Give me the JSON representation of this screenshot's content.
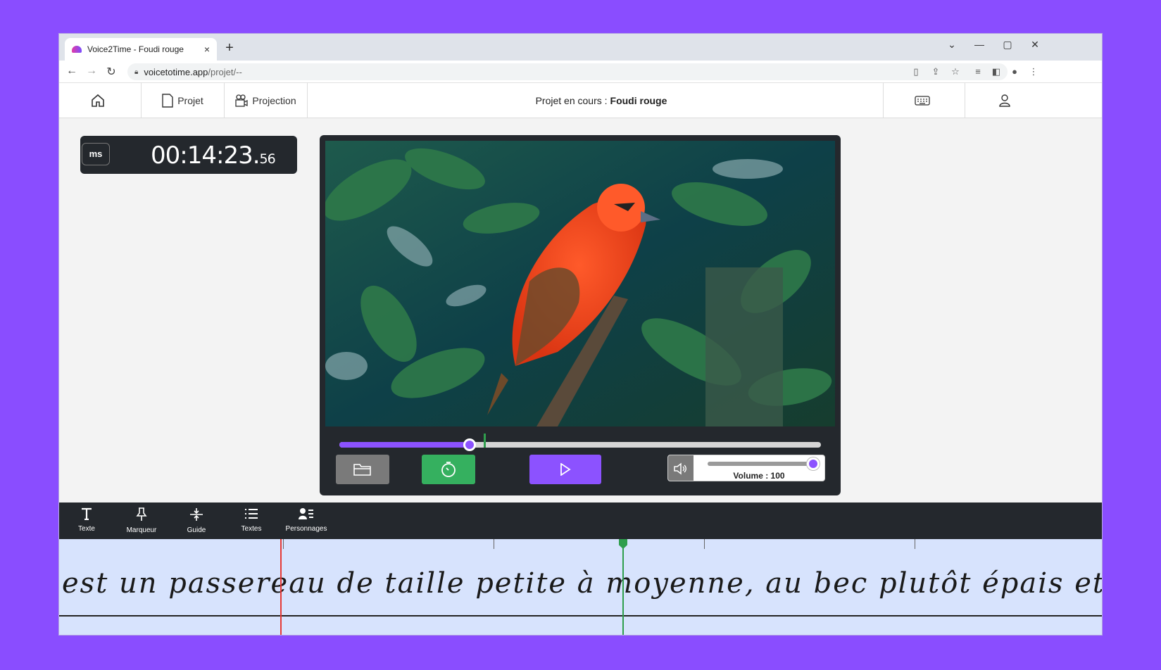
{
  "browser": {
    "tab_title": "Voice2Time - Foudi rouge",
    "tab_close": "×",
    "new_tab": "+",
    "url_host": "voicetotime.app",
    "url_path": "/projet/--",
    "window_controls": {
      "dropdown": "⌄",
      "minimize": "—",
      "maximize": "▢",
      "close": "✕"
    }
  },
  "header": {
    "home_icon": "home-icon",
    "projet_label": "Projet",
    "projection_label": "Projection",
    "project_prefix": "Projet en cours :",
    "project_name": "Foudi rouge",
    "keyboard_icon": "keyboard-icon",
    "user_icon": "user-icon"
  },
  "timer": {
    "ms_label": "ms",
    "time_main": "00:14:23.",
    "time_ms": "56"
  },
  "player": {
    "progress": 0.27,
    "marker_position": 0.3,
    "volume_label": "Volume : 100",
    "volume_value": 100
  },
  "toolbar": {
    "items": [
      {
        "label": "Texte",
        "icon": "text-icon"
      },
      {
        "label": "Marqueur",
        "icon": "pin-icon"
      },
      {
        "label": "Guide",
        "icon": "guide-icon"
      },
      {
        "label": "Textes",
        "icon": "list-icon"
      },
      {
        "label": "Personnages",
        "icon": "characters-icon"
      }
    ]
  },
  "timeline": {
    "text": "est un passereau de taille petite à moyenne, au bec plutôt épais et au pluma"
  },
  "colors": {
    "accent": "#8c52ff",
    "success": "#35b05f",
    "dark": "#24282d",
    "timeline_bg": "#d7e3fd",
    "cursor_red": "#e53935"
  }
}
